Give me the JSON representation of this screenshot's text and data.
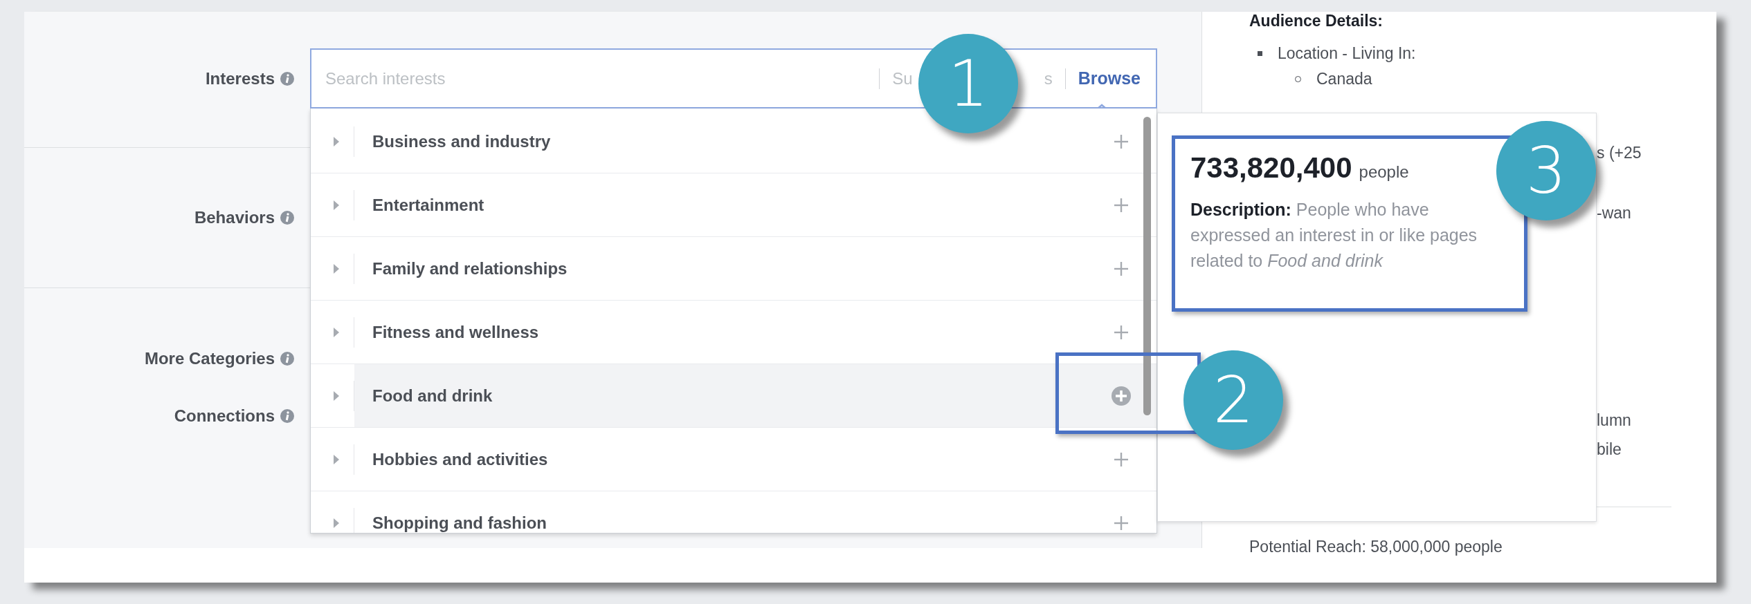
{
  "form": {
    "sections": [
      {
        "labels": [
          "Interests"
        ]
      },
      {
        "labels": [
          "Behaviors"
        ]
      },
      {
        "labels": [
          "More Categories",
          "Connections"
        ]
      }
    ]
  },
  "interest_search": {
    "placeholder": "Search interests",
    "suggestions_parts": [
      "Su",
      "s"
    ],
    "browse": "Browse",
    "categories": [
      {
        "label": "Business and industry",
        "highlighted": false
      },
      {
        "label": "Entertainment",
        "highlighted": false
      },
      {
        "label": "Family and relationships",
        "highlighted": false
      },
      {
        "label": "Fitness and wellness",
        "highlighted": false
      },
      {
        "label": "Food and drink",
        "highlighted": true
      },
      {
        "label": "Hobbies and activities",
        "highlighted": false
      },
      {
        "label": "Shopping and fashion",
        "highlighted": false
      }
    ]
  },
  "popover": {
    "count": "733,820,400",
    "unit": "people",
    "description": "**Description:** People who have expressed an interest in or like pages related to *Food and drink*"
  },
  "audience": {
    "title": "Audience Details:",
    "location_label": "Location - Living In:",
    "locations": [
      "Canada"
    ],
    "fragments": [
      "s (+25",
      "-wan",
      "lumn",
      "bile"
    ],
    "potential_reach": "Potential Reach: 58,000,000 people"
  },
  "callouts": [
    {
      "number": "1"
    },
    {
      "number": "2"
    },
    {
      "number": "3"
    }
  ]
}
